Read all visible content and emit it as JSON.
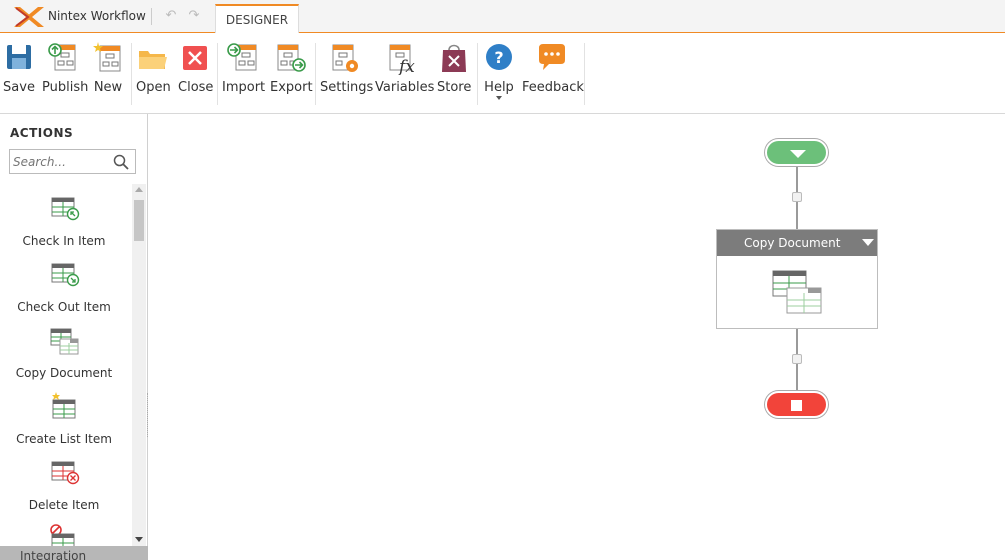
{
  "app": {
    "title": "Nintex Workflow",
    "tab": "DESIGNER"
  },
  "ribbon": [
    {
      "label": "Save",
      "icon": "save-icon"
    },
    {
      "label": "Publish",
      "icon": "publish-icon"
    },
    {
      "label": "New",
      "icon": "new-icon"
    },
    {
      "label": "Open",
      "icon": "open-folder-icon"
    },
    {
      "label": "Close",
      "icon": "close-icon"
    },
    {
      "label": "Import",
      "icon": "import-icon"
    },
    {
      "label": "Export",
      "icon": "export-icon"
    },
    {
      "label": "Settings",
      "icon": "settings-icon"
    },
    {
      "label": "Variables",
      "icon": "variables-icon"
    },
    {
      "label": "Store",
      "icon": "store-icon"
    },
    {
      "label": "Help",
      "icon": "help-icon"
    },
    {
      "label": "Feedback",
      "icon": "feedback-icon"
    }
  ],
  "panel": {
    "title": "ACTIONS",
    "search_placeholder": "Search...",
    "items": [
      {
        "label": "Check In Item"
      },
      {
        "label": "Check Out Item"
      },
      {
        "label": "Copy Document"
      },
      {
        "label": "Create List Item"
      },
      {
        "label": "Delete Item"
      },
      {
        "label": ""
      }
    ],
    "category": "Integration"
  },
  "canvas": {
    "action_title": "Copy Document"
  },
  "colors": {
    "accent": "#f08a24",
    "start": "#6cc07a",
    "end": "#f2443a",
    "action_header": "#7c7c7c"
  }
}
